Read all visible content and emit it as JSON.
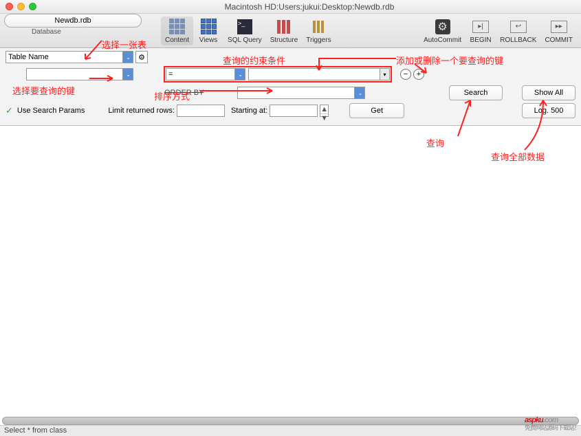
{
  "window": {
    "title": "Macintosh HD:Users:jukui:Desktop:Newdb.rdb"
  },
  "db_button": {
    "label": "Newdb.rdb",
    "caption": "Database"
  },
  "toolbar": {
    "content": "Content",
    "views": "Views",
    "sqlquery": "SQL Query",
    "structure": "Structure",
    "triggers": "Triggers",
    "autocommit": "AutoCommit",
    "begin": "BEGIN",
    "rollback": "ROLLBACK",
    "commit": "COMMIT"
  },
  "controls": {
    "table_name": "Table Name",
    "operator": "=",
    "order_by": "ORDER BY",
    "use_search": "Use Search Params",
    "limit_rows": "Limit returned rows:",
    "starting_at": "Starting at:",
    "get": "Get",
    "search": "Search",
    "show_all": "Show All",
    "log": "Log.",
    "log_num": "500"
  },
  "annotations": {
    "select_table": "选择一张表",
    "query_cond": "查询的约束条件",
    "add_remove": "添加或删除一个要查询的键",
    "select_key": "选择要查询的键",
    "sort_way": "排序方式",
    "query": "查询",
    "query_all": "查询全部数据"
  },
  "status": {
    "text": "Select * from class"
  },
  "watermark": {
    "brand": "aspku",
    "domain": ".com",
    "sub": "免费网站源码下载站！"
  }
}
